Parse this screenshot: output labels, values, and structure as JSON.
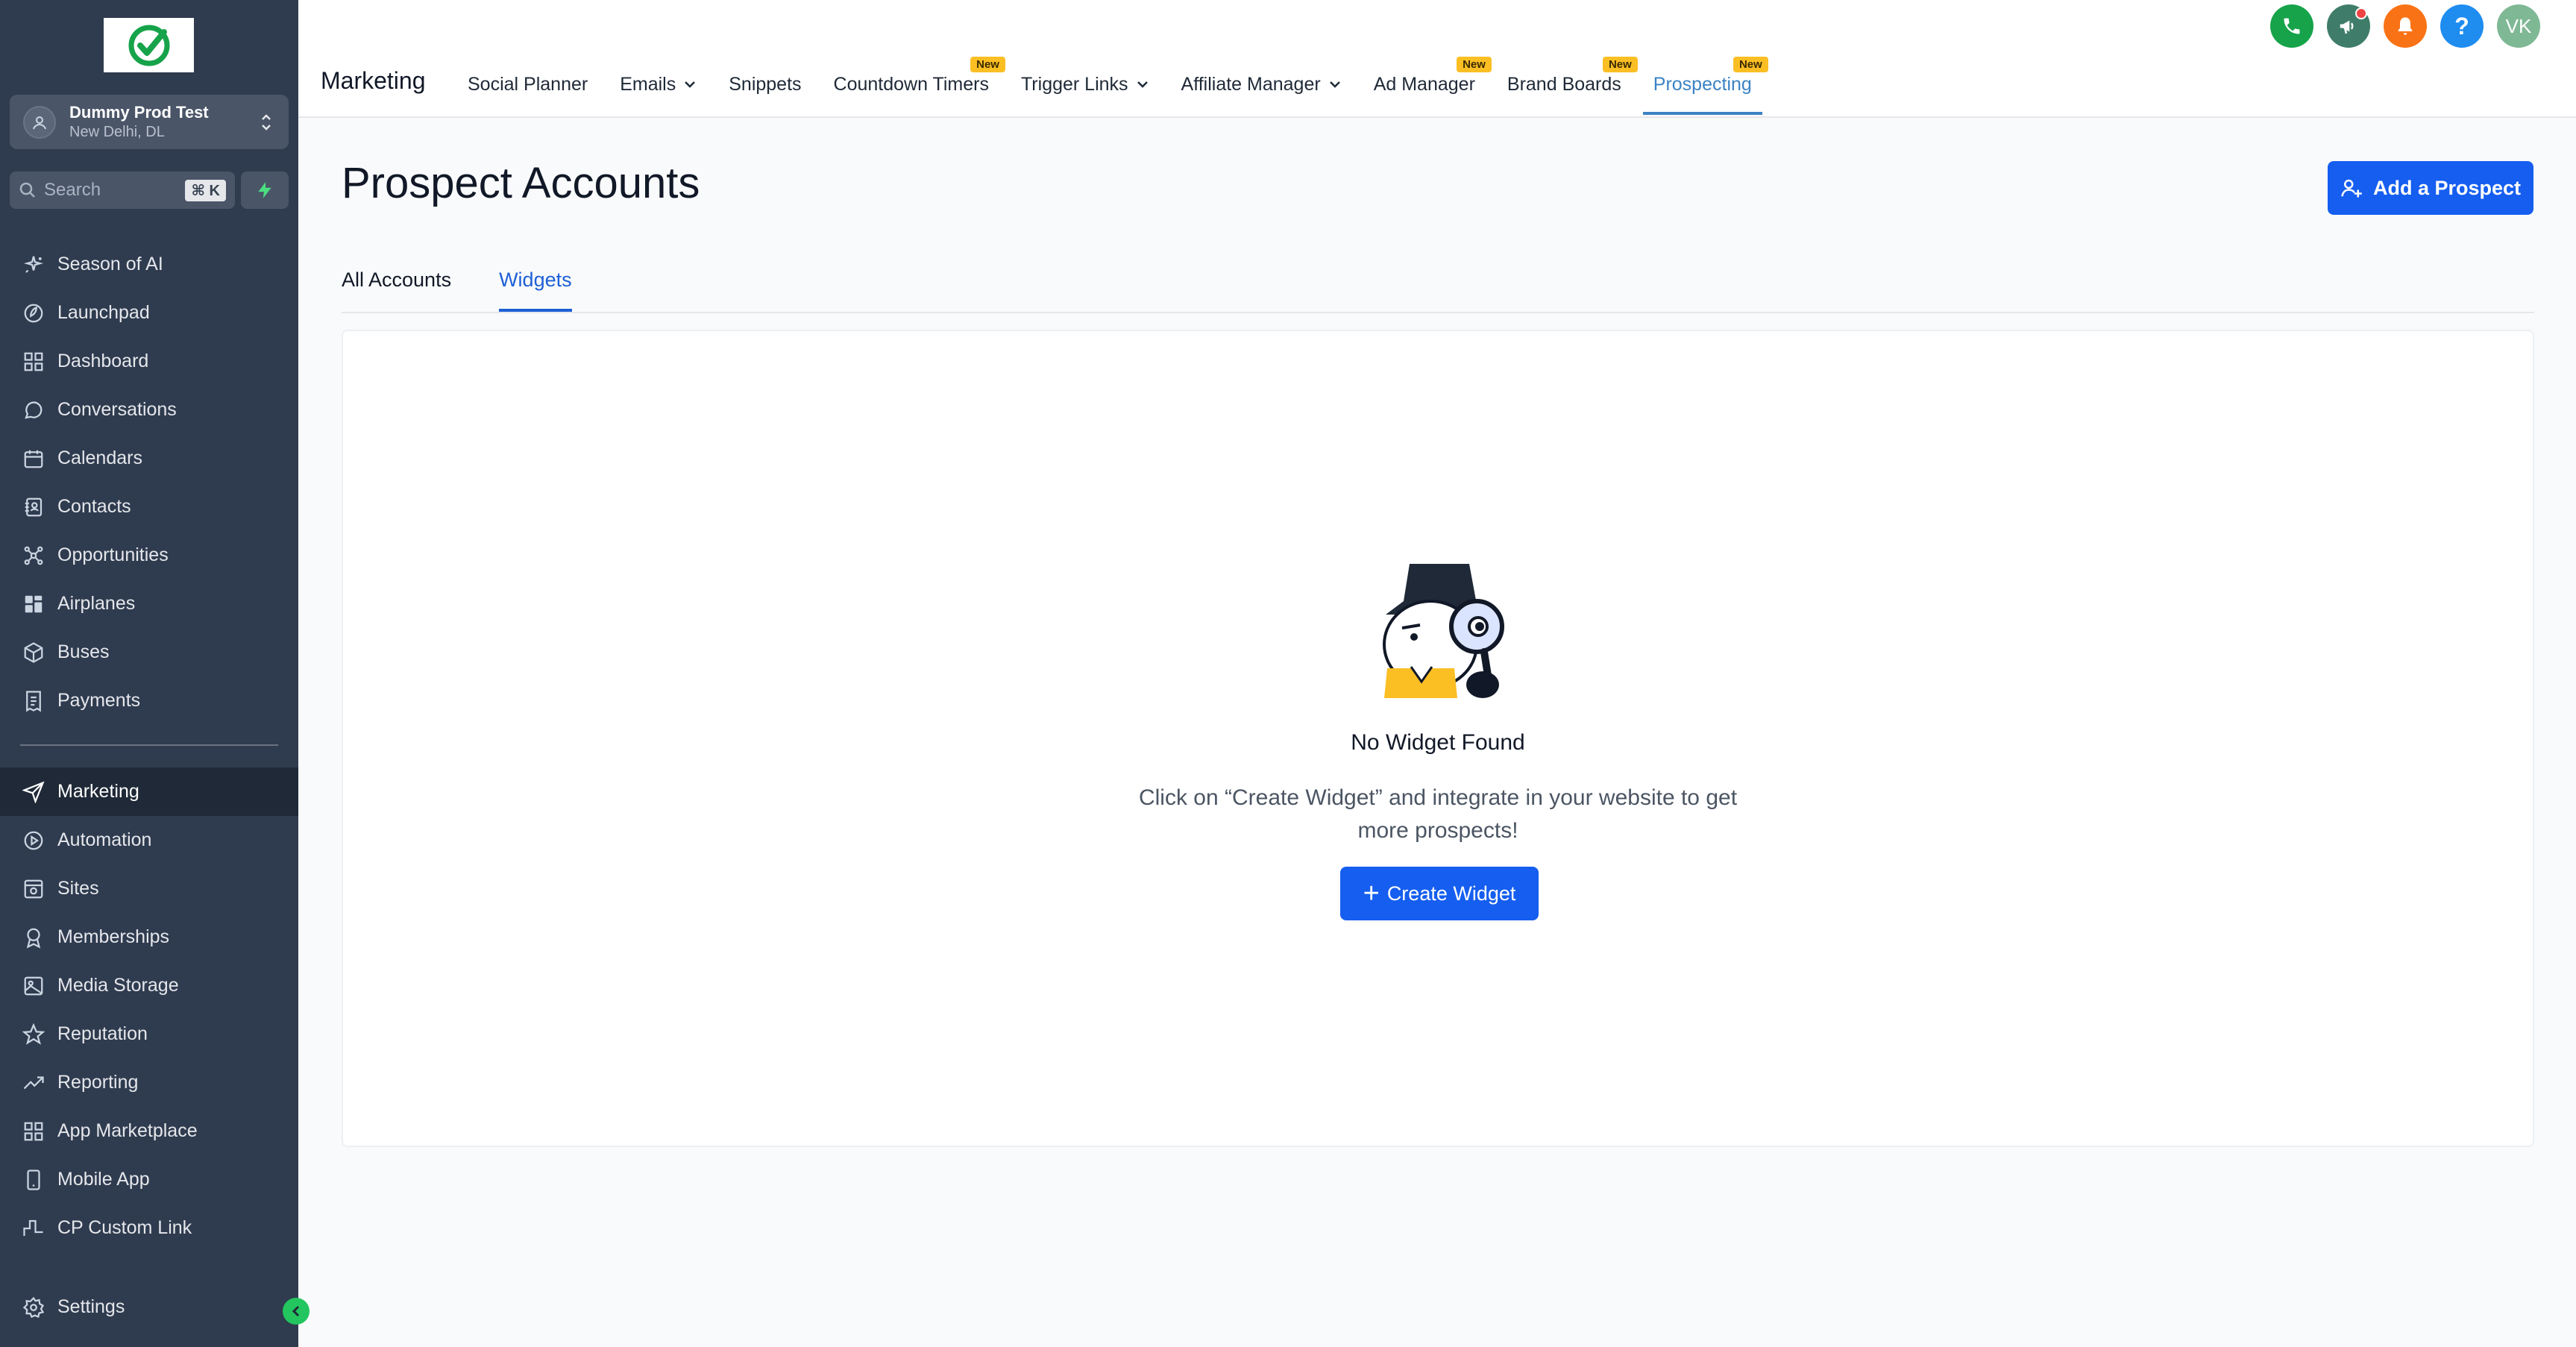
{
  "sidebar": {
    "account": {
      "name": "Dummy Prod Test",
      "location": "New Delhi, DL"
    },
    "search": {
      "placeholder": "Search",
      "shortcut": "⌘ K"
    },
    "items": [
      {
        "label": "Season of AI",
        "icon": "sparkle-icon"
      },
      {
        "label": "Launchpad",
        "icon": "rocket-icon"
      },
      {
        "label": "Dashboard",
        "icon": "grid-icon"
      },
      {
        "label": "Conversations",
        "icon": "chat-icon"
      },
      {
        "label": "Calendars",
        "icon": "calendar-icon"
      },
      {
        "label": "Contacts",
        "icon": "contacts-icon"
      },
      {
        "label": "Opportunities",
        "icon": "network-icon"
      },
      {
        "label": "Airplanes",
        "icon": "apps-icon"
      },
      {
        "label": "Buses",
        "icon": "box-icon"
      },
      {
        "label": "Payments",
        "icon": "receipt-icon"
      },
      {
        "label": "Marketing",
        "icon": "send-icon"
      },
      {
        "label": "Automation",
        "icon": "automation-icon"
      },
      {
        "label": "Sites",
        "icon": "sites-icon"
      },
      {
        "label": "Memberships",
        "icon": "award-icon"
      },
      {
        "label": "Media Storage",
        "icon": "image-icon"
      },
      {
        "label": "Reputation",
        "icon": "star-icon"
      },
      {
        "label": "Reporting",
        "icon": "trend-icon"
      },
      {
        "label": "App Marketplace",
        "icon": "grid-icon"
      },
      {
        "label": "Mobile App",
        "icon": "phone-device-icon"
      },
      {
        "label": "CP Custom Link",
        "icon": "signal-icon"
      }
    ],
    "settings_label": "Settings",
    "active_item": "Marketing"
  },
  "topbar": {
    "module_title": "Marketing",
    "nav": [
      {
        "label": "Social Planner"
      },
      {
        "label": "Emails",
        "dropdown": true
      },
      {
        "label": "Snippets"
      },
      {
        "label": "Countdown Timers",
        "badge": "New"
      },
      {
        "label": "Trigger Links",
        "dropdown": true
      },
      {
        "label": "Affiliate Manager",
        "dropdown": true
      },
      {
        "label": "Ad Manager",
        "badge": "New"
      },
      {
        "label": "Brand Boards",
        "badge": "New"
      },
      {
        "label": "Prospecting",
        "badge": "New",
        "active": true
      }
    ],
    "user_initials": "VK",
    "icon_colors": {
      "phone": "#16a34a",
      "announcement": "#3f7d6a",
      "notifications": "#f97316",
      "help": "#1f8cf0",
      "avatar": "#7fb894"
    }
  },
  "main": {
    "page_title": "Prospect Accounts",
    "add_button_label": "Add a Prospect",
    "tabs": [
      {
        "label": "All Accounts"
      },
      {
        "label": "Widgets",
        "active": true
      }
    ],
    "empty_state": {
      "title": "No Widget Found",
      "description": "Click on “Create Widget” and integrate in your website to get more prospects!",
      "button_label": "Create Widget"
    }
  },
  "colors": {
    "sidebar_bg": "#2f3b4f",
    "primary": "#155eef",
    "active_tab": "#3b82c4",
    "badge": "#fbbf24"
  }
}
